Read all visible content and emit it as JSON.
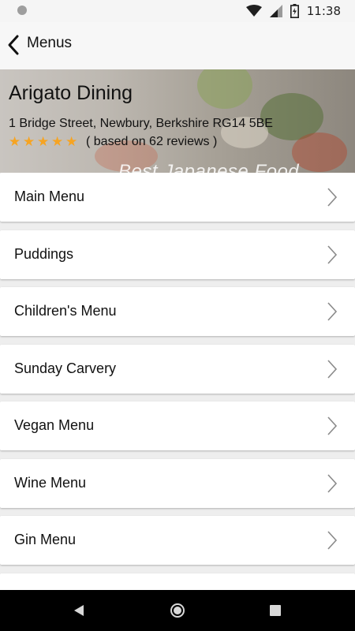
{
  "status_bar": {
    "time": "11:38"
  },
  "app_bar": {
    "title": "Menus"
  },
  "restaurant": {
    "name": "Arigato Dining",
    "address": "1 Bridge Street, Newbury, Berkshire RG14 5BE",
    "rating_stars": 5,
    "reviews_text": "( based on 62 reviews )",
    "banner_text": "Best Japanese Food"
  },
  "menus": [
    {
      "label": "Main Menu"
    },
    {
      "label": "Puddings"
    },
    {
      "label": "Children's Menu"
    },
    {
      "label": "Sunday Carvery"
    },
    {
      "label": "Vegan Menu"
    },
    {
      "label": "Wine Menu"
    },
    {
      "label": "Gin Menu"
    }
  ],
  "colors": {
    "star": "#f6a422",
    "list_background": "#eeeeee",
    "nav_bar": "#000000"
  },
  "icons": {
    "back": "chevron-left-icon",
    "row": "chevron-right-icon",
    "status": [
      "notification-dot-icon",
      "wifi-icon",
      "signal-icon",
      "battery-icon"
    ],
    "nav": [
      "nav-back-icon",
      "nav-home-icon",
      "nav-recents-icon"
    ]
  }
}
